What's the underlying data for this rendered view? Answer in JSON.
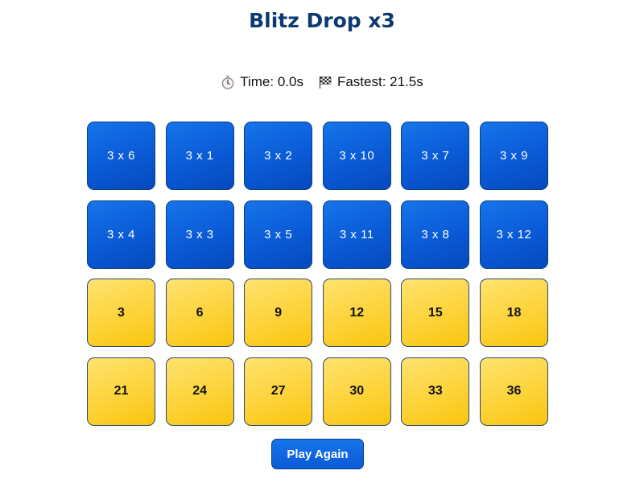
{
  "title": "Blitz Drop x3",
  "stats": {
    "time_icon": "stopwatch-icon",
    "time_text": "Time: 0.0s",
    "fastest_icon": "checkered-flag-icon",
    "fastest_text": "Fastest: 21.5s"
  },
  "questions": [
    "3 x 6",
    "3 x 1",
    "3 x 2",
    "3 x 10",
    "3 x 7",
    "3 x 9",
    "3 x 4",
    "3 x 3",
    "3 x 5",
    "3 x 11",
    "3 x 8",
    "3 x 12"
  ],
  "answers": [
    "3",
    "6",
    "9",
    "12",
    "15",
    "18",
    "21",
    "24",
    "27",
    "30",
    "33",
    "36"
  ],
  "play_again_label": "Play Again",
  "colors": {
    "title": "#0d3a75",
    "question_tile": "#0a5ad6",
    "answer_tile": "#fdd33a"
  }
}
